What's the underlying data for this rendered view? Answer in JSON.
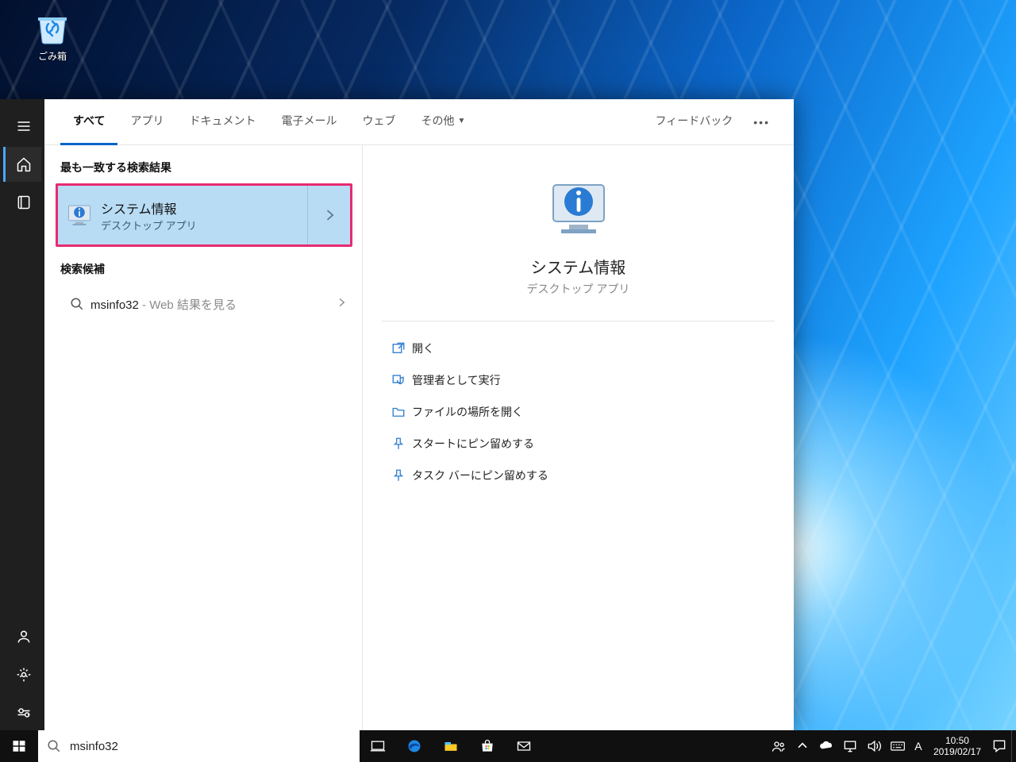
{
  "desktop": {
    "recycle_bin_label": "ごみ箱"
  },
  "search_rail_icon": "home",
  "tabs": {
    "all": "すべて",
    "apps": "アプリ",
    "documents": "ドキュメント",
    "email": "電子メール",
    "web": "ウェブ",
    "more": "その他",
    "feedback": "フィードバック"
  },
  "best_match_header": "最も一致する検索結果",
  "best_match": {
    "title": "システム情報",
    "subtitle": "デスクトップ アプリ"
  },
  "suggestions_header": "検索候補",
  "suggestion": {
    "term": "msinfo32",
    "suffix": " - Web 結果を見る"
  },
  "preview": {
    "title": "システム情報",
    "subtitle": "デスクトップ アプリ"
  },
  "actions": {
    "open": "開く",
    "run_as_admin": "管理者として実行",
    "open_location": "ファイルの場所を開く",
    "pin_start": "スタートにピン留めする",
    "pin_taskbar": "タスク バーにピン留めする"
  },
  "taskbar": {
    "search_value": "msinfo32",
    "ime_indicator": "A",
    "clock_time": "10:50",
    "clock_date": "2019/02/17"
  }
}
